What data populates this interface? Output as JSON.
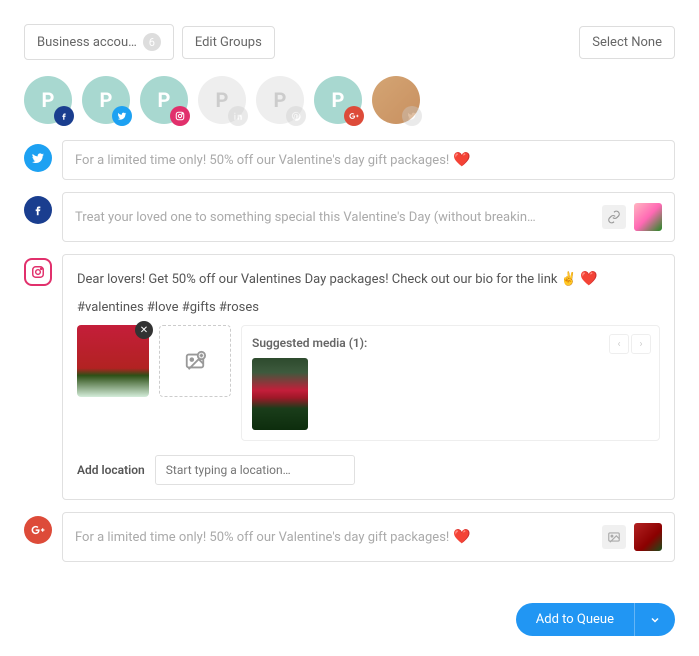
{
  "topbar": {
    "account_label": "Business accou…",
    "account_count": "6",
    "edit_groups": "Edit Groups",
    "select_none": "Select None"
  },
  "networks": {
    "facebook_color": "#1a3e8f",
    "twitter_color": "#1da1f2",
    "instagram_color": "#e1306c",
    "linkedin_color": "#cccccc",
    "pinterest_color": "#cccccc",
    "gplus_color": "#dd4b39"
  },
  "rows": {
    "twitter": {
      "placeholder": "For a limited time only! 50% off our Valentine's day gift packages!"
    },
    "facebook": {
      "placeholder": "Treat your loved one to something special this Valentine's Day (without breakin…"
    },
    "instagram": {
      "text": "Dear lovers! Get 50% off our Valentines Day packages! Check out our bio for the link",
      "emoji_hand": "✌️",
      "emoji_heart": "❤️",
      "hashtags": "#valentines #love #gifts #roses",
      "suggested_label": "Suggested media (1):",
      "add_location_label": "Add location",
      "location_placeholder": "Start typing a location…"
    },
    "gplus": {
      "placeholder": "For a limited time only! 50% off our Valentine's day gift packages!"
    }
  },
  "footer": {
    "queue_label": "Add to Queue"
  }
}
